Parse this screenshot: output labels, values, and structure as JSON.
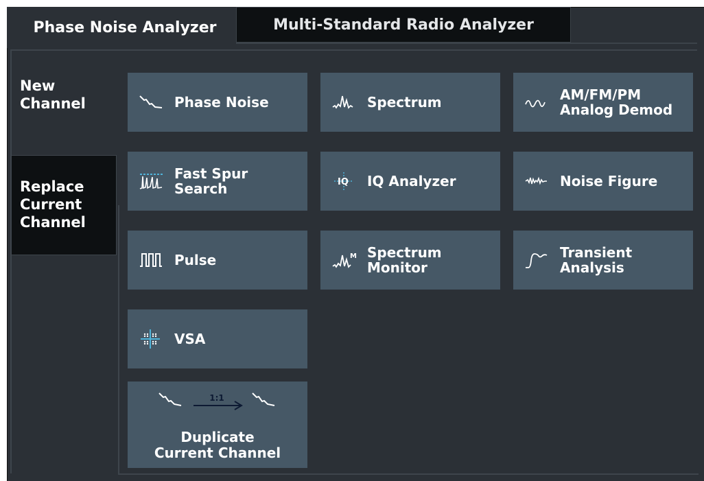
{
  "tabs": [
    {
      "label": "Phase Noise Analyzer",
      "active": true
    },
    {
      "label": "Multi-Standard Radio Analyzer",
      "active": false
    }
  ],
  "side_tabs": {
    "new_channel": "New\nChannel",
    "replace_channel": "Replace\nCurrent\nChannel"
  },
  "apps": [
    {
      "label": "Phase Noise",
      "icon": "phase-noise-icon"
    },
    {
      "label": "Spectrum",
      "icon": "spectrum-icon"
    },
    {
      "label": "AM/FM/PM\nAnalog Demod",
      "icon": "analog-demod-icon"
    },
    {
      "label": "Fast Spur\nSearch",
      "icon": "fast-spur-search-icon"
    },
    {
      "label": "IQ Analyzer",
      "icon": "iq-analyzer-icon"
    },
    {
      "label": "Noise Figure",
      "icon": "noise-figure-icon"
    },
    {
      "label": "Pulse",
      "icon": "pulse-icon"
    },
    {
      "label": "Spectrum\nMonitor",
      "icon": "spectrum-monitor-icon"
    },
    {
      "label": "Transient\nAnalysis",
      "icon": "transient-analysis-icon"
    },
    {
      "label": "VSA",
      "icon": "vsa-icon"
    }
  ],
  "duplicate": {
    "label": "Duplicate\nCurrent Channel",
    "ratio": "1:1",
    "icon": "duplicate-channel-icon"
  },
  "colors": {
    "background": "#2b3036",
    "tile": "#465866",
    "dark_tab": "#0d1012",
    "icon_accent": "#4fb3d9"
  }
}
